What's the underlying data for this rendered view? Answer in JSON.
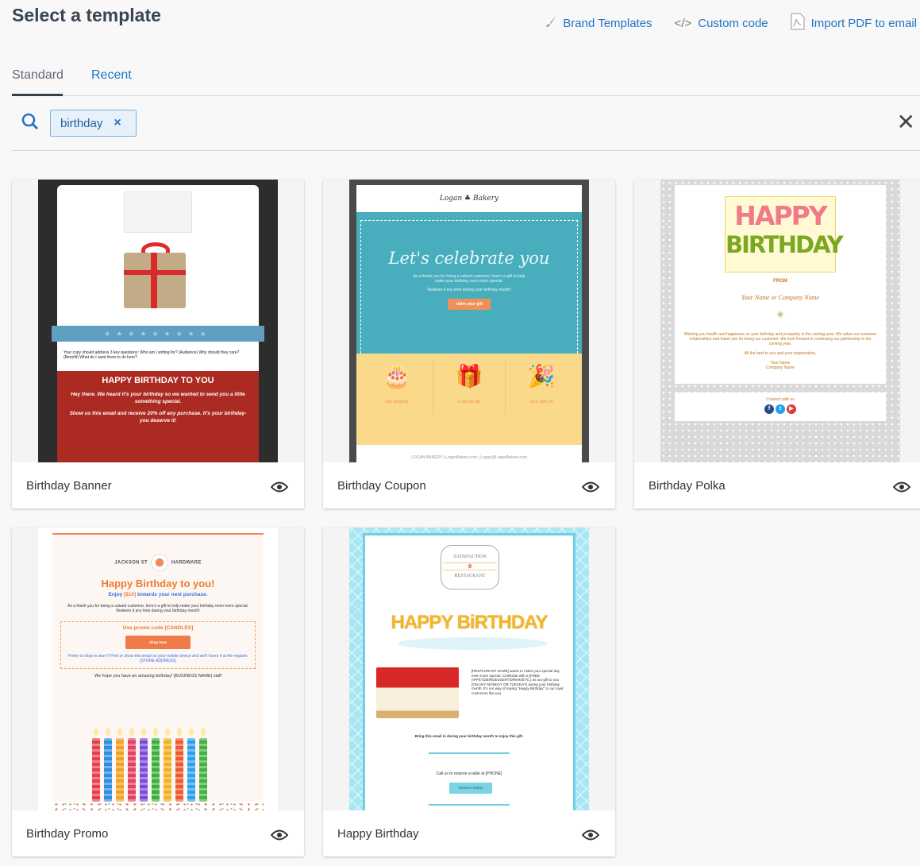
{
  "header": {
    "title": "Select a template",
    "actions": [
      {
        "label": "Brand Templates",
        "icon": "brush-icon"
      },
      {
        "label": "Custom code",
        "icon": "code-icon"
      },
      {
        "label": "Import PDF to email",
        "icon": "pdf-file-icon"
      }
    ]
  },
  "tabs": [
    {
      "label": "Standard",
      "active": true
    },
    {
      "label": "Recent",
      "active": false
    }
  ],
  "search": {
    "icon": "search-icon",
    "chips": [
      {
        "label": "birthday",
        "remove": "×"
      }
    ],
    "clear": "✕"
  },
  "colors": {
    "accent": "#1f74c4",
    "tab_indicator": "#34404a"
  },
  "templates": [
    {
      "name": "Birthday Banner",
      "preview": {
        "stars": "★★★★★★★★★",
        "copy": "Your copy should address 3 key questions: Who am I writing for? (Audience) Why should they care? (Benefit) What do I want them to do here?",
        "heading": "HAPPY BIRTHDAY TO YOU",
        "p1": "Hey there. We heard it's your birthday so we wanted to send you a little something special.",
        "p2": "Show us this email and receive 20% off any purchase. It's your birthday-you deserve it!"
      }
    },
    {
      "name": "Birthday Coupon",
      "preview": {
        "logo": "Logan ♣ Bakery",
        "script": "Let's celebrate you",
        "p1": "As a thank you for being a valued customer, here's a gift to help make your birthday even more special.",
        "p2": "Redeem it any time during your birthday month!",
        "button": "claim your gift",
        "perks": [
          "free shipping",
          "a special gift",
          "up to 30% off"
        ],
        "footer": "LOGAN BAKERY | LoganBakery.com | Logan@LoganBakery.com"
      }
    },
    {
      "name": "Birthday Polka",
      "preview": {
        "happy": "HAPPY",
        "birthday": "BIRTHDAY",
        "from": "FROM",
        "your_name": "Your Name or Company Name",
        "msg": "Wishing you health and happiness on your birthday and prosperity in the coming year. We value our customer relationships and thank you for being our customer. We look forward to continuing our partnership in the coming year.",
        "best": "All the best to you and your organization,",
        "sig1": "Your Name",
        "sig2": "Company Name",
        "connect": "Connect with us"
      }
    },
    {
      "name": "Birthday Promo",
      "preview": {
        "logo_left": "JACKSON ST",
        "logo_right": "HARDWARE",
        "heading": "Happy Birthday to you!",
        "enjoy_a": "Enjoy ",
        "enjoy_amt": "[$10]",
        "enjoy_b": " towards your next purchase.",
        "p1": "As a thank you for being a valued customer, here's a gift to help make your birthday even more special. Redeem it any time during your birthday month!",
        "code": "Use promo code [CANDLES]",
        "button": "Shop Now",
        "pref": "Prefer to shop in store? Print or show this email on your mobile device and we'll honor it at the register. [STORE ADDRESS]",
        "hope": "We hope you have an amazing birthday! [BUSINESS NAME] staff"
      }
    },
    {
      "name": "Happy Birthday",
      "preview": {
        "badge_top": "SATISFACTION",
        "badge_bottom": "RESTAURANT",
        "heading": "HAPPY BiRTHDAY",
        "text": "[RESTAURANT NAME] wants to make your special day even more special. Celebrate with a [FREE APPETIZER/DESSERT/DRINK/ETC.] as our gift to you [ON ANY MONDAY OR TUESDAY] during your birthday month. It's our way of saying \"Happy Birthday\" to our loyal customers like you.",
        "bring": "Bring this email in during your birthday month to enjoy this gift.",
        "call": "Call us to reserve a table at [PHONE]",
        "button": "Reserve Online"
      }
    }
  ],
  "card_action_icon": "eye-icon"
}
